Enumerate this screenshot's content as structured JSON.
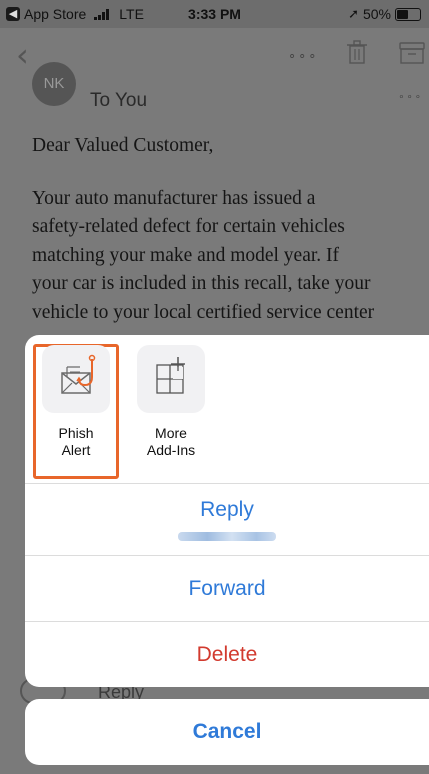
{
  "status_bar": {
    "back_app": "App Store",
    "network": "LTE",
    "time": "3:33 PM",
    "battery": "50%"
  },
  "nav": {
    "more": "∘∘∘"
  },
  "email": {
    "avatar_initials": "NK",
    "recipient": "To You",
    "more": "∘∘∘",
    "body": [
      "Dear Valued Customer,",
      "Your auto manufacturer has issued a",
      "safety-related defect for certain vehicles",
      "matching your make and model year. If",
      "your car is included in this recall, take your",
      "vehicle to your local certified service center"
    ]
  },
  "action_sheet": {
    "addins": [
      {
        "label_line1": "Phish",
        "label_line2": "Alert",
        "icon": "phish-alert-icon"
      },
      {
        "label_line1": "More",
        "label_line2": "Add-Ins",
        "icon": "more-addins-icon"
      }
    ],
    "reply": "Reply",
    "forward": "Forward",
    "delete": "Delete",
    "cancel": "Cancel"
  },
  "reply_bar": {
    "label": "Reply"
  },
  "colors": {
    "accent": "#2f7ad8",
    "destructive": "#d23a2e",
    "highlight": "#e8662a"
  }
}
